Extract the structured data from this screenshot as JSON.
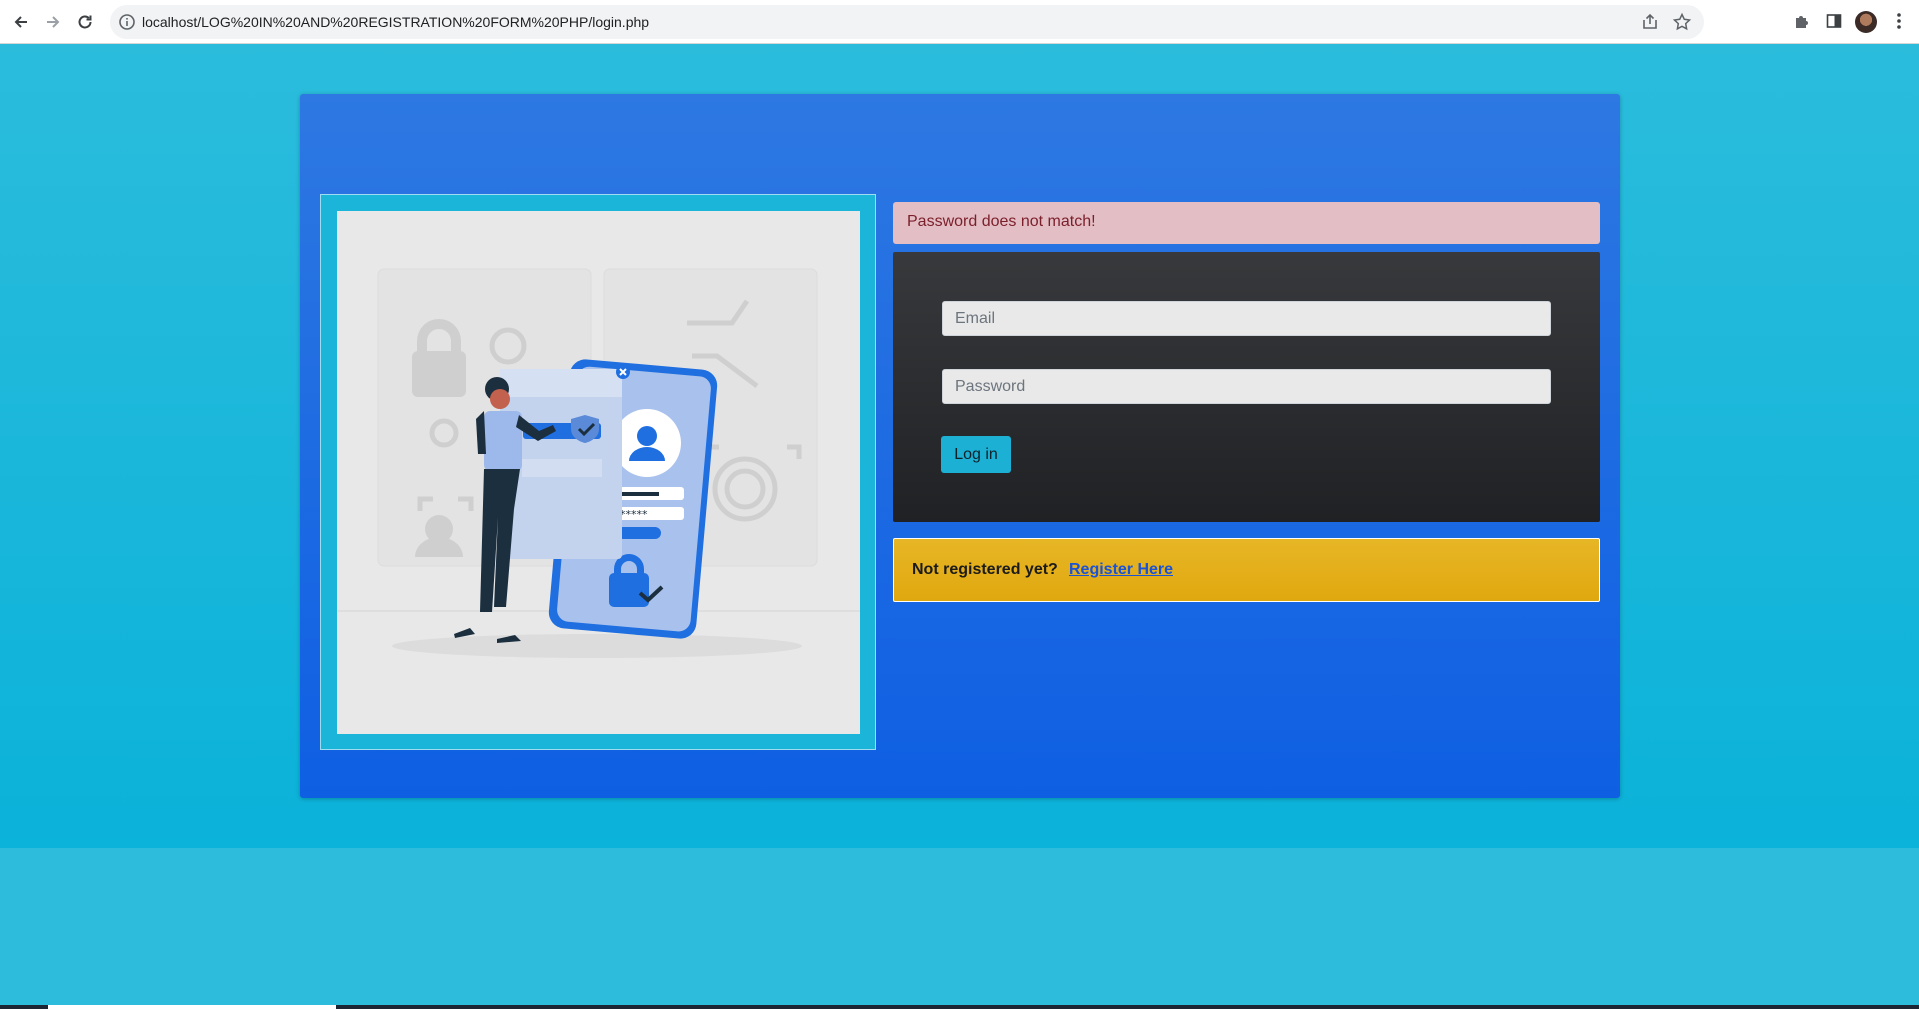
{
  "browser": {
    "url": "localhost/LOG%20IN%20AND%20REGISTRATION%20FORM%20PHP/login.php",
    "icons": [
      "back-icon",
      "forward-icon",
      "reload-icon",
      "info-icon",
      "share-icon",
      "star-icon",
      "extensions-icon",
      "side-panel-icon",
      "profile-avatar",
      "more-icon"
    ]
  },
  "alert": {
    "message": "Password does not match!"
  },
  "form": {
    "email_placeholder": "Email",
    "password_placeholder": "Password",
    "login_label": "Log in"
  },
  "register": {
    "question": "Not registered yet?",
    "link_label": "Register Here"
  },
  "colors": {
    "page_bg": "#2bbcdc",
    "card_bg": "#1e68e3",
    "alert_bg": "#e3bec5",
    "form_bg": "#2b2d30",
    "button_bg": "#1bb0d4",
    "register_bg": "#e3af1a",
    "link_color": "#1a53d6"
  }
}
